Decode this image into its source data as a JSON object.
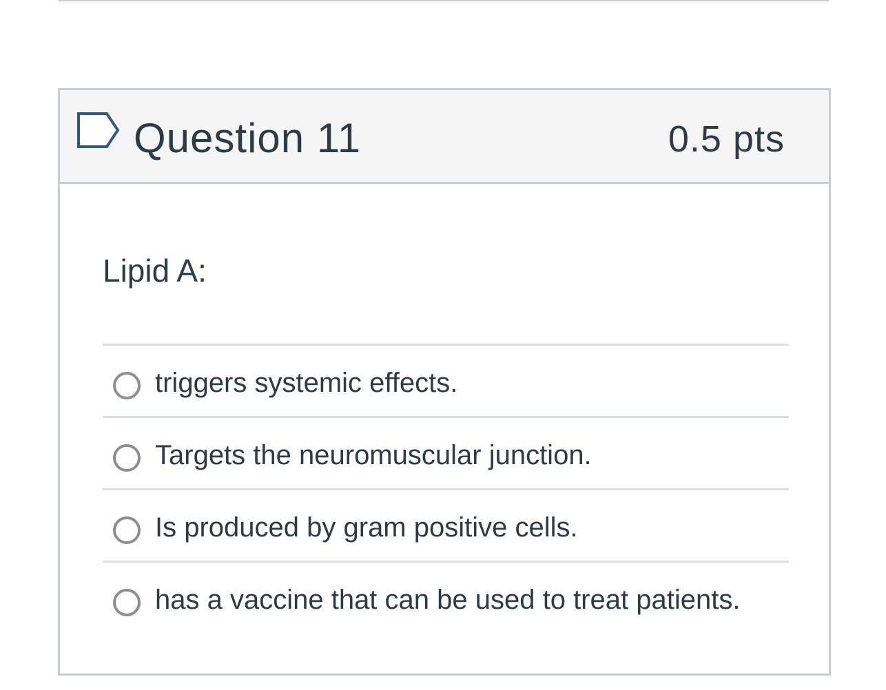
{
  "question": {
    "title": "Question 11",
    "points": "0.5 pts",
    "flag_icon": "flag-outline-icon",
    "prompt": "Lipid A:",
    "answers": [
      {
        "label": "triggers systemic effects."
      },
      {
        "label": "Targets the neuromuscular junction."
      },
      {
        "label": "Is produced by gram positive cells."
      },
      {
        "label": "has a vaccine that can be used to treat patients."
      }
    ]
  },
  "colors": {
    "accent": "#2d5b8a",
    "text": "#2d3b45",
    "header_bg": "#f5f5f5",
    "border": "#c7cdd1"
  }
}
